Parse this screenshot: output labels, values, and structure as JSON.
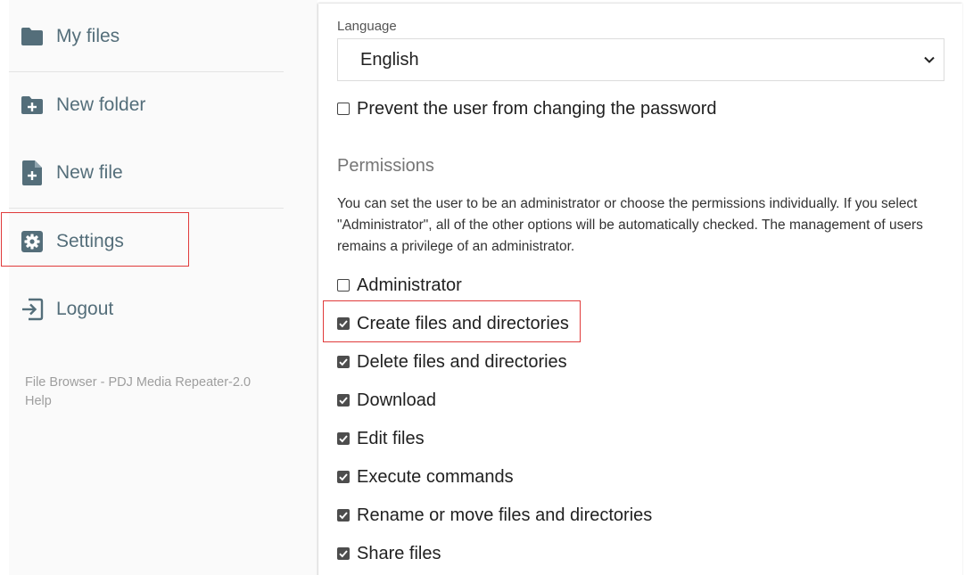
{
  "sidebar": {
    "items": [
      {
        "label": "My files",
        "icon": "folder-icon"
      },
      {
        "label": "New folder",
        "icon": "folder-plus-icon"
      },
      {
        "label": "New file",
        "icon": "file-plus-icon"
      },
      {
        "label": "Settings",
        "icon": "gear-icon"
      },
      {
        "label": "Logout",
        "icon": "logout-icon"
      }
    ],
    "footer": {
      "app_name": "File Browser - PDJ Media Repeater-2.0",
      "help": "Help"
    }
  },
  "settings": {
    "language": {
      "label": "Language",
      "selected": "English"
    },
    "prevent_password_change": {
      "label": "Prevent the user from changing the password",
      "checked": false
    },
    "permissions": {
      "title": "Permissions",
      "description": "You can set the user to be an administrator or choose the permissions individually. If you select \"Administrator\", all of the other options will be automatically checked. The management of users remains a privilege of an administrator.",
      "options": [
        {
          "label": "Administrator",
          "checked": false
        },
        {
          "label": "Create files and directories",
          "checked": true
        },
        {
          "label": "Delete files and directories",
          "checked": true
        },
        {
          "label": "Download",
          "checked": true
        },
        {
          "label": "Edit files",
          "checked": true
        },
        {
          "label": "Execute commands",
          "checked": true
        },
        {
          "label": "Rename or move files and directories",
          "checked": true
        },
        {
          "label": "Share files",
          "checked": true
        }
      ]
    }
  },
  "colors": {
    "icon": "#546e7a",
    "highlight": "#e03a3a",
    "checkbox_checked": "#4d4d4d"
  }
}
